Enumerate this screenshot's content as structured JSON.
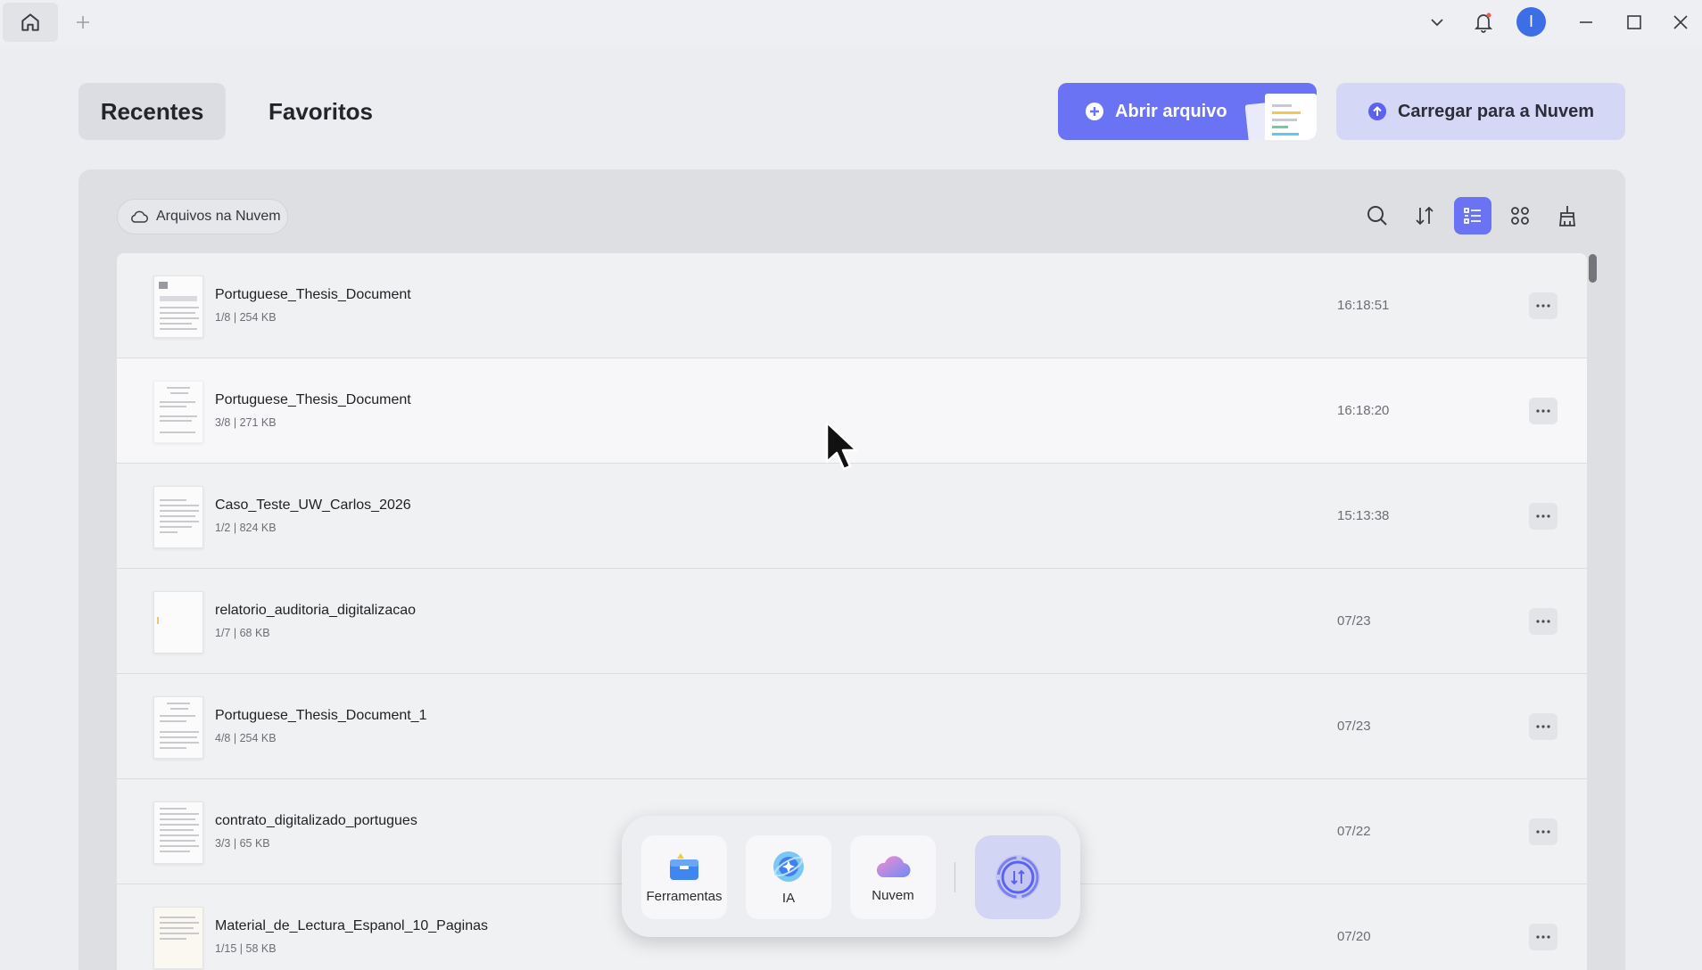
{
  "header": {
    "tabs": [
      {
        "label": "Recentes",
        "active": true
      },
      {
        "label": "Favoritos",
        "active": false
      }
    ],
    "open_file_label": "Abrir arquivo",
    "upload_cloud_label": "Carregar para a Nuvem"
  },
  "titlebar": {
    "avatar_initial": "I"
  },
  "toolbar": {
    "cloud_files_label": "Arquivos na Nuvem"
  },
  "files": [
    {
      "name": "Portuguese_Thesis_Document",
      "meta": "1/8 | 254 KB",
      "time": "16:18:51"
    },
    {
      "name": "Portuguese_Thesis_Document",
      "meta": "3/8 | 271 KB",
      "time": "16:18:20"
    },
    {
      "name": "Caso_Teste_UW_Carlos_2026",
      "meta": "1/2 | 824 KB",
      "time": "15:13:38"
    },
    {
      "name": "relatorio_auditoria_digitalizacao",
      "meta": "1/7 | 68 KB",
      "time": "07/23"
    },
    {
      "name": "Portuguese_Thesis_Document_1",
      "meta": "4/8 | 254 KB",
      "time": "07/23"
    },
    {
      "name": "contrato_digitalizado_portugues",
      "meta": "3/3 | 65 KB",
      "time": "07/22"
    },
    {
      "name": "Material_de_Lectura_Espanol_10_Paginas",
      "meta": "1/15 | 58 KB",
      "time": "07/20"
    }
  ],
  "dock": {
    "tools_label": "Ferramentas",
    "ai_label": "IA",
    "cloud_label": "Nuvem"
  },
  "colors": {
    "accent": "#6b73f5",
    "accent_light": "#d5d7f6",
    "avatar": "#3e6ee6"
  }
}
